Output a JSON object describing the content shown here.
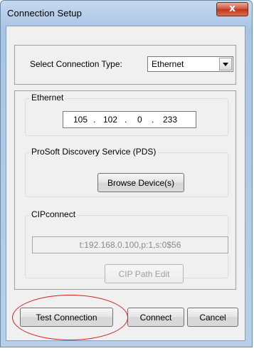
{
  "window": {
    "title": "Connection Setup",
    "close_label": "x"
  },
  "connection_type": {
    "label": "Select Connection Type:",
    "value": "Ethernet"
  },
  "ethernet": {
    "group_label": "Ethernet",
    "ip_octets": [
      "105",
      "102",
      "0",
      "233"
    ],
    "separator": "."
  },
  "pds": {
    "group_label": "ProSoft Discovery Service (PDS)",
    "browse_label": "Browse Device(s)"
  },
  "cipconnect": {
    "group_label": "CIPconnect",
    "path_value": "t:192.168.0.100,p:1,s:0$56",
    "edit_label": "CIP Path Edit"
  },
  "buttons": {
    "test_label": "Test Connection",
    "connect_label": "Connect",
    "cancel_label": "Cancel"
  },
  "colors": {
    "highlight_circle": "#d42020",
    "title_bar": "#b9cfe8",
    "close_button": "#c0351c"
  }
}
